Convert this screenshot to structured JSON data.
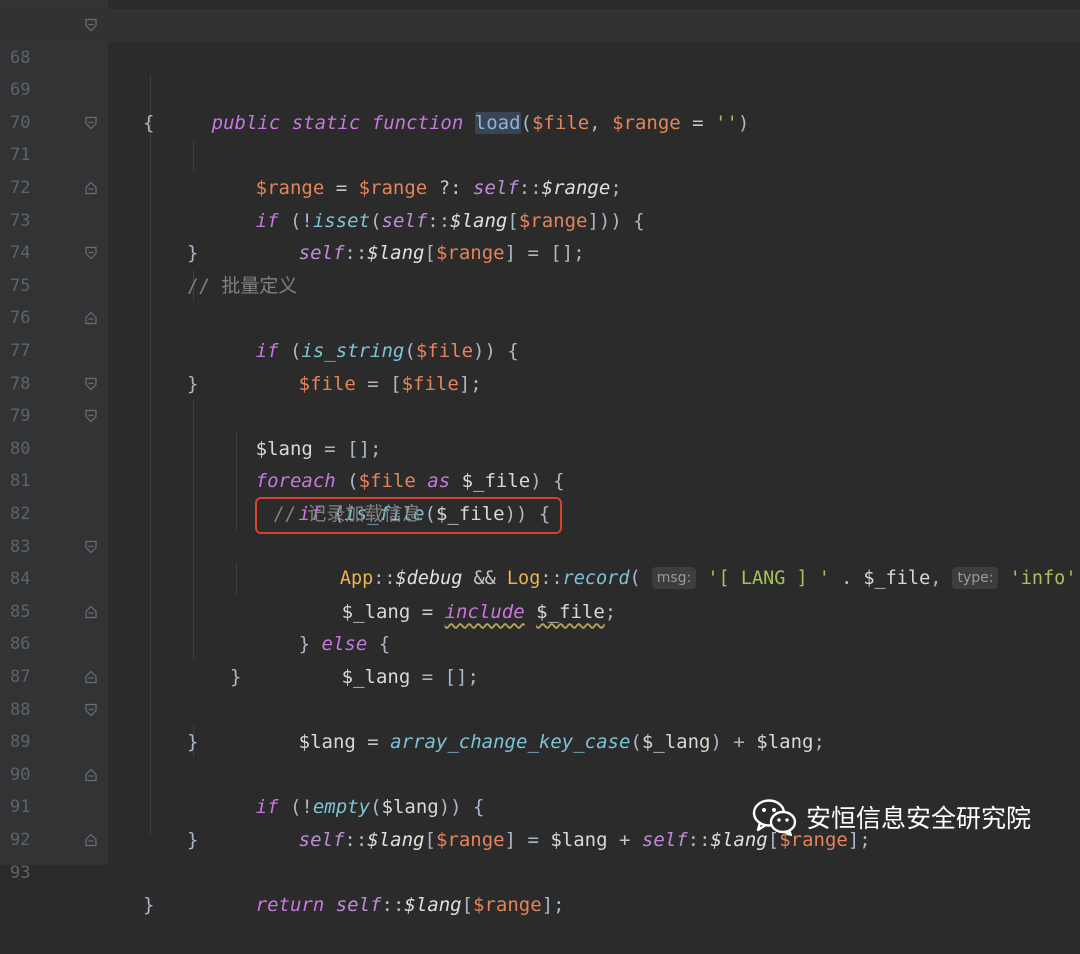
{
  "editor": {
    "lines": [
      {
        "num": "68",
        "fold": "open",
        "current": true
      },
      {
        "num": "69",
        "fold": ""
      },
      {
        "num": "70",
        "fold": ""
      },
      {
        "num": "71",
        "fold": "open"
      },
      {
        "num": "72",
        "fold": ""
      },
      {
        "num": "73",
        "fold": "close"
      },
      {
        "num": "74",
        "fold": ""
      },
      {
        "num": "75",
        "fold": "open"
      },
      {
        "num": "76",
        "fold": ""
      },
      {
        "num": "77",
        "fold": "close"
      },
      {
        "num": "78",
        "fold": ""
      },
      {
        "num": "79",
        "fold": "open"
      },
      {
        "num": "80",
        "fold": "open"
      },
      {
        "num": "81",
        "fold": ""
      },
      {
        "num": "82",
        "fold": ""
      },
      {
        "num": "83",
        "fold": ""
      },
      {
        "num": "84",
        "fold": "open"
      },
      {
        "num": "85",
        "fold": ""
      },
      {
        "num": "86",
        "fold": "close"
      },
      {
        "num": "87",
        "fold": ""
      },
      {
        "num": "88",
        "fold": "close"
      },
      {
        "num": "89",
        "fold": "open"
      },
      {
        "num": "90",
        "fold": ""
      },
      {
        "num": "91",
        "fold": "close"
      },
      {
        "num": "92",
        "fold": ""
      },
      {
        "num": "93",
        "fold": "close"
      }
    ],
    "code": {
      "l68": [
        "public static function ",
        "load",
        "(",
        "$file",
        ", ",
        "$range",
        " = ",
        "''",
        ")"
      ],
      "l69": [
        "{"
      ],
      "l70": [
        "$range",
        " = ",
        "$range",
        " ?: ",
        "self",
        "::",
        "$range",
        ";"
      ],
      "l71": [
        "if",
        " (!",
        "isset",
        "(",
        "self",
        "::",
        "$lang",
        "[",
        "$range",
        "])) {"
      ],
      "l72": [
        "self",
        "::",
        "$lang",
        "[",
        "$range",
        "] = [];"
      ],
      "l73": [
        "}"
      ],
      "l74": [
        "// 批量定义"
      ],
      "l75": [
        "if",
        " (",
        "is_string",
        "(",
        "$file",
        ")) {"
      ],
      "l76": [
        "$file",
        " = [",
        "$file",
        "];"
      ],
      "l77": [
        "}"
      ],
      "l78": [
        "$lang",
        " = [];"
      ],
      "l79": [
        "foreach",
        " (",
        "$file",
        " as ",
        "$_file",
        ") {"
      ],
      "l80": [
        "if",
        " (",
        "is_file",
        "(",
        "$_file",
        ")) {"
      ],
      "l81": [
        "// 记录加载信息"
      ],
      "l82": [
        "App",
        "::",
        "$debug",
        " && ",
        "Log",
        "::",
        "record",
        "(",
        "msg:",
        "'[ LANG ] '",
        " . ",
        "$_file",
        ", ",
        "type:",
        "'info'",
        ");"
      ],
      "l83": [
        "$_lang",
        " = ",
        "include",
        " ",
        "$_file",
        ";"
      ],
      "l84": [
        "} ",
        "else",
        " {"
      ],
      "l85": [
        "$_lang",
        " = [];"
      ],
      "l86": [
        "}"
      ],
      "l87": [
        "$lang",
        " = ",
        "array_change_key_case",
        "(",
        "$_lang",
        ") + ",
        "$lang",
        ";"
      ],
      "l88": [
        "}"
      ],
      "l89": [
        "if",
        " (!",
        "empty",
        "(",
        "$lang",
        ")) {"
      ],
      "l90": [
        "self",
        "::",
        "$lang",
        "[",
        "$range",
        "] = ",
        "$lang",
        " + ",
        "self",
        "::",
        "$lang",
        "[",
        "$range",
        "];"
      ],
      "l91": [
        "}"
      ],
      "l92": [
        "return",
        " ",
        "self",
        "::",
        "$lang",
        "[",
        "$range",
        "];"
      ],
      "l93": [
        "}"
      ]
    }
  },
  "watermark": {
    "text": "安恒信息安全研究院",
    "icon": "wechat-icon"
  },
  "colors": {
    "highlight_box": "#d9402e",
    "background": "#2b2b2b",
    "gutter": "#313335"
  }
}
